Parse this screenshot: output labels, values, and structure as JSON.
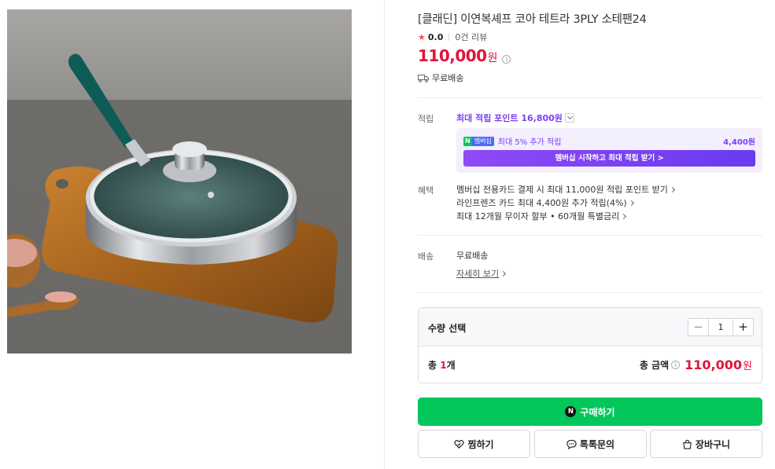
{
  "product": {
    "title": "[클래딘] 이연복셰프 코아 테트라 3PLY 소테팬24",
    "rating": "0.0",
    "reviews": "0건 리뷰",
    "price": "110,000",
    "currency": "원",
    "shipping_badge": "무료배송"
  },
  "points": {
    "label": "적립",
    "max_points": "최대 적립 포인트 16,800원",
    "badge_n": "N",
    "badge_plus": "멤버십",
    "membership_text": "최대 5% 추가 적립",
    "membership_amount": "4,400원",
    "membership_button": "멤버십 시작하고 최대 적립 받기 >"
  },
  "benefits": {
    "label": "혜택",
    "items": [
      "멤버십 전용카드 결제 시 최대 11,000원 적립 포인트 받기",
      "라인프렌즈 카드 최대 4,400원 추가 적립(4%)",
      "최대 12개월 무이자 할부 • 60개월 특별금리"
    ]
  },
  "delivery": {
    "label": "배송",
    "value": "무료배송",
    "detail_link": "자세히 보기"
  },
  "quantity": {
    "label": "수량 선택",
    "minus": "−",
    "value": "1",
    "plus": "+",
    "total_count_prefix": "총 ",
    "total_count_num": "1",
    "total_count_suffix": "개",
    "total_label": "총 금액",
    "total_price": "110,000",
    "total_currency": "원"
  },
  "actions": {
    "buy": "구매하기",
    "buy_icon_letter": "N",
    "wish": "찜하기",
    "talk": "톡톡문의",
    "cart": "장바구니"
  },
  "colors": {
    "accent_red": "#e0143c",
    "naver_green": "#03c75a",
    "membership_purple": "#7b3ff2"
  }
}
